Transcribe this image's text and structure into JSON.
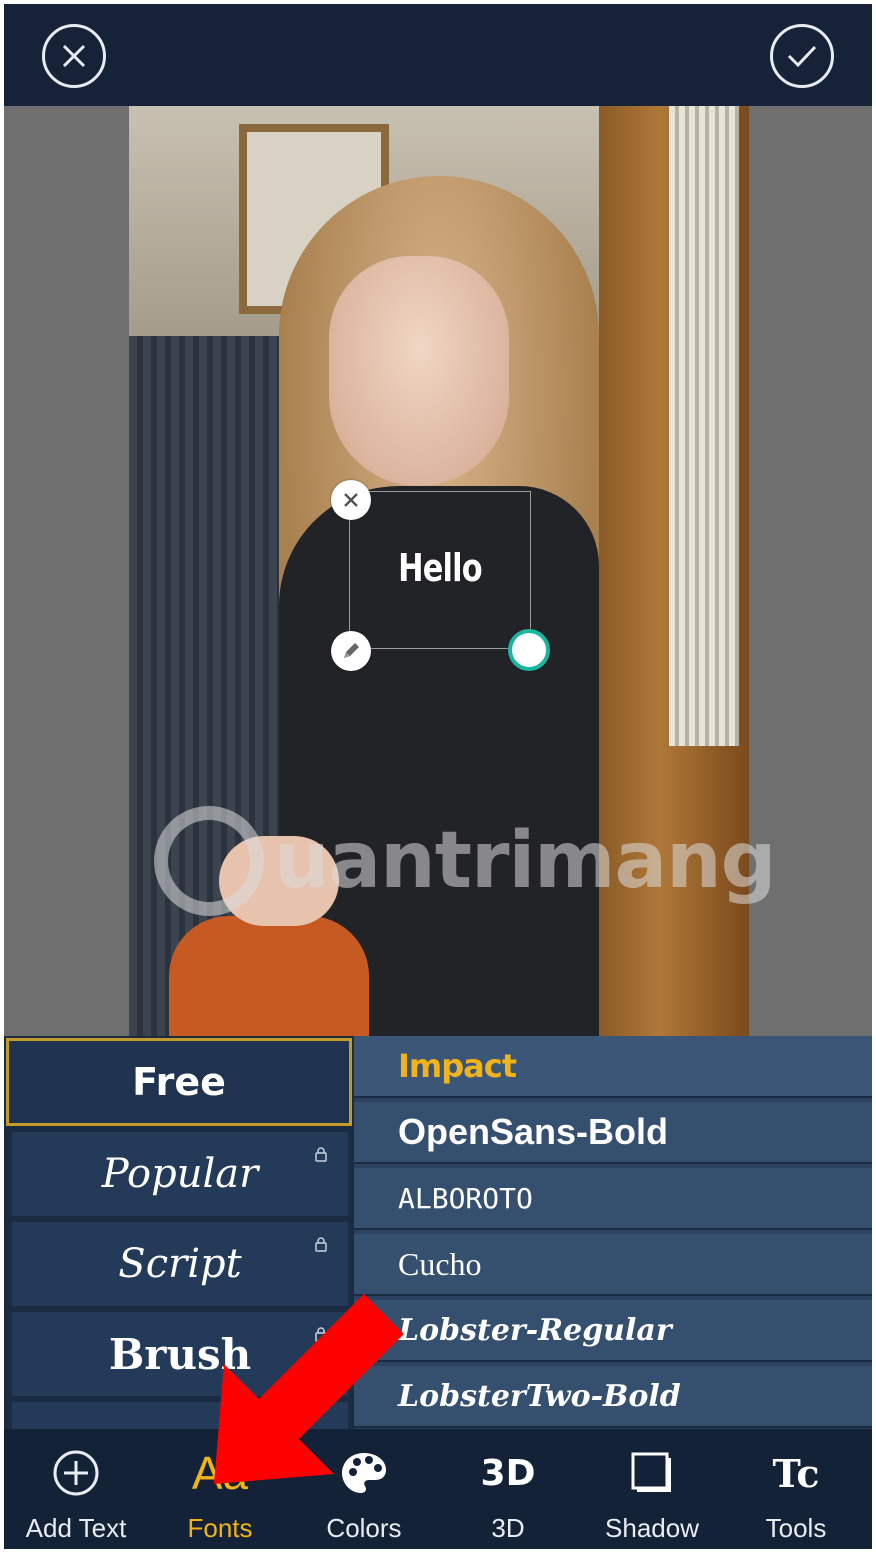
{
  "topbar": {
    "close_icon": "close-icon",
    "confirm_icon": "checkmark-icon"
  },
  "canvas": {
    "text_layer": "Hello",
    "watermark": "uantrimang"
  },
  "font_categories": [
    {
      "label": "Free",
      "selected": true,
      "locked": false
    },
    {
      "label": "Popular",
      "selected": false,
      "locked": true
    },
    {
      "label": "Script",
      "selected": false,
      "locked": true
    },
    {
      "label": "Brush",
      "selected": false,
      "locked": true
    }
  ],
  "fonts": [
    {
      "label": "Impact",
      "selected": true
    },
    {
      "label": "OpenSans-Bold",
      "selected": false
    },
    {
      "label": "ALBOROTO",
      "selected": false
    },
    {
      "label": "Cucho",
      "selected": false
    },
    {
      "label": "Lobster-Regular",
      "selected": false
    },
    {
      "label": "LobsterTwo-Bold",
      "selected": false
    }
  ],
  "toolbar": {
    "items": [
      {
        "label": "Add Text",
        "icon": "plus-circle-icon"
      },
      {
        "label": "Fonts",
        "icon": "Aa",
        "active": true
      },
      {
        "label": "Colors",
        "icon": "palette-icon"
      },
      {
        "label": "3D",
        "icon": "3D"
      },
      {
        "label": "Shadow",
        "icon": "shadow-square-icon"
      },
      {
        "label": "Tools",
        "icon": "Tc"
      }
    ]
  },
  "colors": {
    "accent": "#f1b418",
    "background": "#152238",
    "handle": "#18b6a2",
    "annotation_arrow": "#ff0000"
  }
}
